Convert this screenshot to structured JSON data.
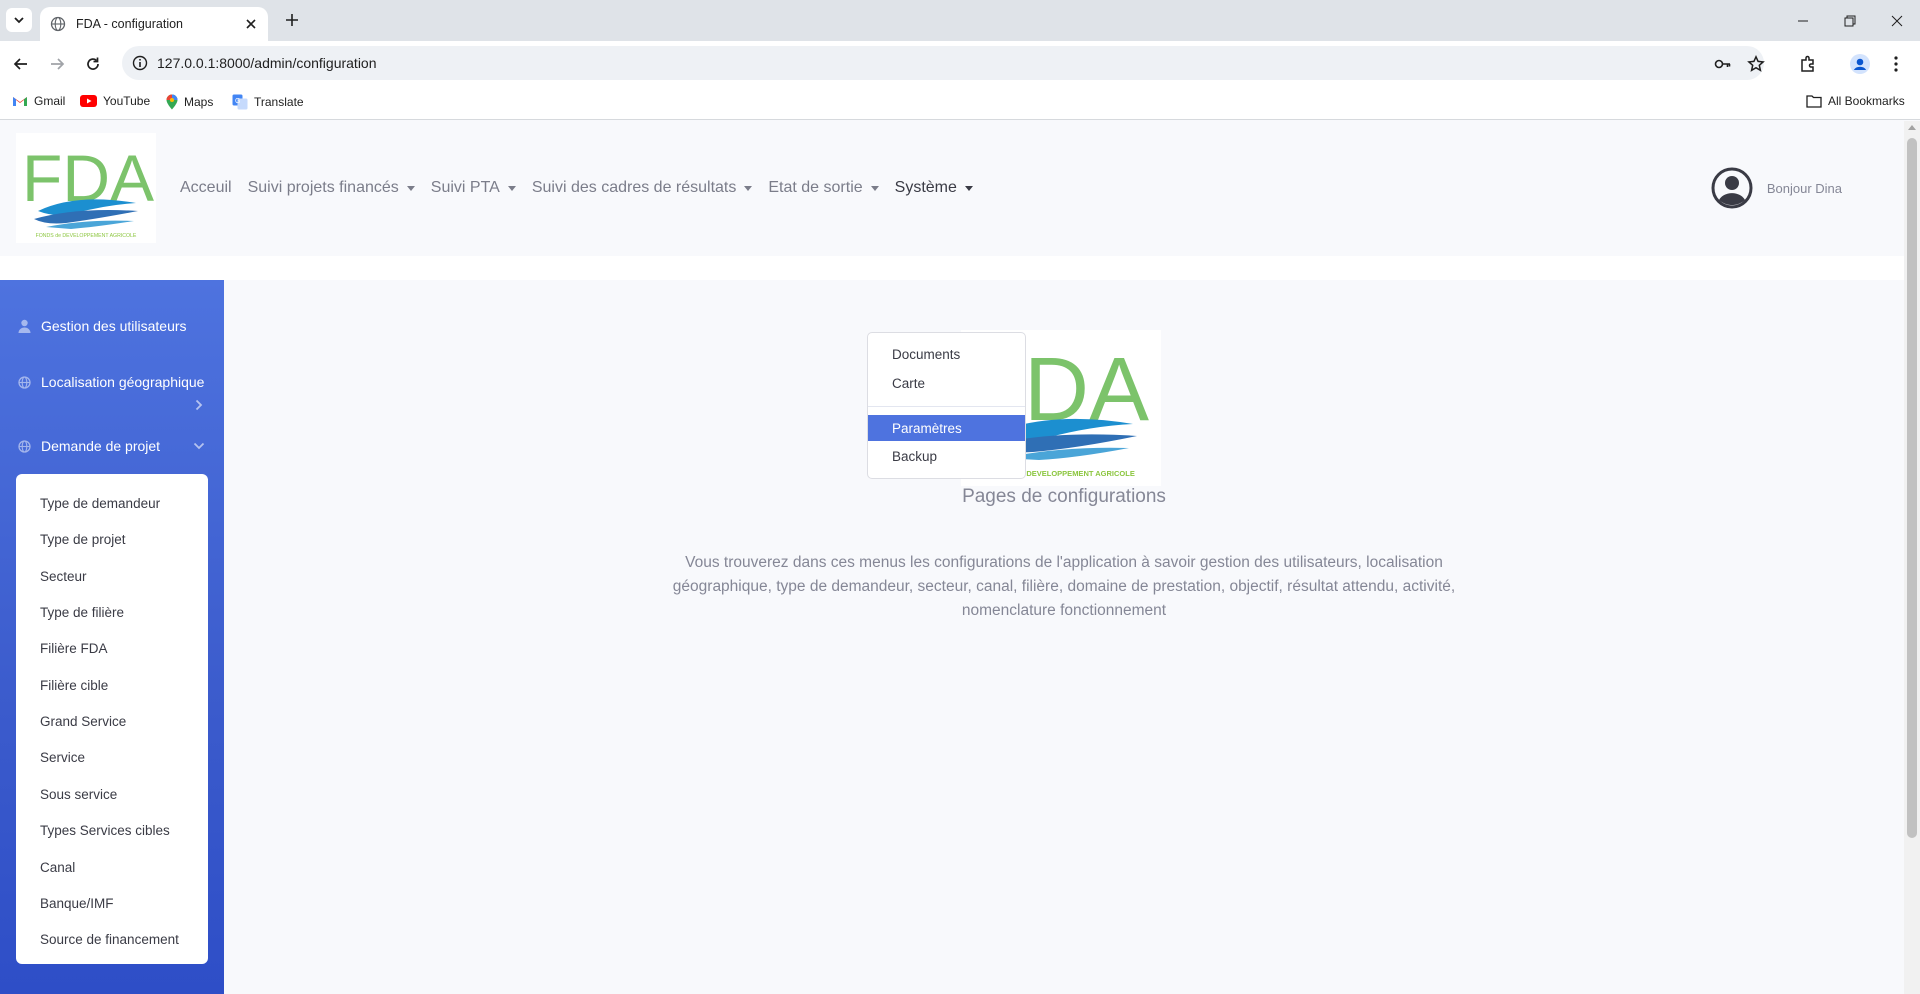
{
  "browser": {
    "tab_title": "FDA - configuration",
    "url": "127.0.0.1:8000/admin/configuration",
    "bookmarks": [
      "Gmail",
      "YouTube",
      "Maps",
      "Translate"
    ],
    "all_bookmarks": "All Bookmarks"
  },
  "nav": {
    "logo_text": "FDA",
    "logo_subtext": "FONDS de DEVELOPPEMENT AGRICOLE",
    "links": [
      "Acceuil",
      "Suivi projets financés",
      "Suivi PTA",
      "Suivi des cadres de résultats",
      "Etat de sortie",
      "Système"
    ],
    "greeting": "Bonjour Dina"
  },
  "dropdown": {
    "items": [
      "Documents",
      "Carte",
      "Paramètres",
      "Backup"
    ],
    "active": "Paramètres"
  },
  "sidebar": {
    "items": [
      "Gestion des utilisateurs",
      "Localisation géographique",
      "Demande de projet"
    ],
    "submenu": [
      "Type de demandeur",
      "Type de projet",
      "Secteur",
      "Type de filière",
      "Filière FDA",
      "Filière cible",
      "Grand Service",
      "Service",
      "Sous service",
      "Types Services cibles",
      "Canal",
      "Banque/IMF",
      "Source de financement"
    ]
  },
  "content": {
    "logo_text": "FDA",
    "logo_subtext": "FONDS de DEVELOPPEMENT AGRICOLE",
    "title": "Pages de configurations",
    "description": "Vous trouverez dans ces menus les configurations de l'application à savoir gestion des utilisateurs, localisation géographique, type de demandeur, secteur, canal, filière, domaine de prestation, objectif, résultat attendu, activité, nomenclature fonctionnement"
  },
  "colors": {
    "sidebar": "#4e73df",
    "active_item": "#4e73df",
    "logo_green": "#7cc36b",
    "logo_blue": "#2f8fd0"
  }
}
